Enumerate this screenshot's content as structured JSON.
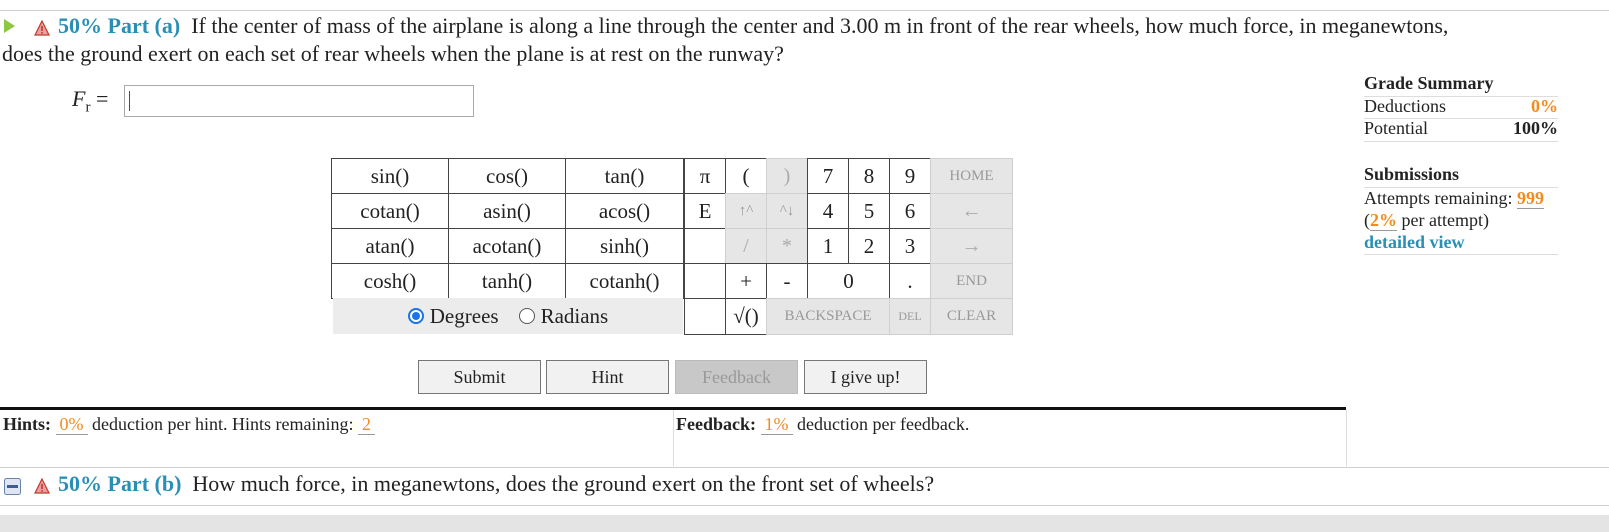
{
  "part_a": {
    "title": "50% Part (a)",
    "question_line1": "If the center of mass of the airplane is along a line through the center and 3.00 m in front of the rear wheels, how much force, in meganewtons,",
    "question_line2": "does the ground exert on each set of rear wheels when the plane is at rest on the runway?",
    "answer_label": "F",
    "answer_sub": "r",
    "answer_eq": "=",
    "answer_value": ""
  },
  "keypad": {
    "functions": [
      [
        "sin()",
        "cos()",
        "tan()"
      ],
      [
        "cotan()",
        "asin()",
        "acos()"
      ],
      [
        "atan()",
        "acotan()",
        "sinh()"
      ],
      [
        "cosh()",
        "tanh()",
        "cotanh()"
      ]
    ],
    "mode_degrees": "Degrees",
    "mode_radians": "Radians",
    "pi": "π",
    "lparen": "(",
    "rparen": ")",
    "e": "E",
    "up": "↑^",
    "down": "^↓",
    "slash": "/",
    "star": "*",
    "plus": "+",
    "minus": "-",
    "n7": "7",
    "n8": "8",
    "n9": "9",
    "n4": "4",
    "n5": "5",
    "n6": "6",
    "n1": "1",
    "n2": "2",
    "n3": "3",
    "n0": "0",
    "dot": ".",
    "sqrt": "√()",
    "home": "HOME",
    "left": "←",
    "right": "→",
    "end": "END",
    "backspace": "BACKSPACE",
    "del": "DEL",
    "clear": "CLEAR"
  },
  "buttons": {
    "submit": "Submit",
    "hint": "Hint",
    "feedback": "Feedback",
    "give_up": "I give up!"
  },
  "hints": {
    "label": "Hints:",
    "pct": "0%",
    "text": "deduction per hint. Hints remaining:",
    "remaining": "2"
  },
  "feedback": {
    "label": "Feedback:",
    "pct": "1%",
    "text": "deduction per feedback."
  },
  "grade_summary": {
    "title": "Grade Summary",
    "deductions_label": "Deductions",
    "deductions_value": "0%",
    "potential_label": "Potential",
    "potential_value": "100%"
  },
  "submissions": {
    "title": "Submissions",
    "attempts_label": "Attempts remaining:",
    "attempts_value": "999",
    "per_attempt_pct": "2%",
    "per_attempt_text": "per attempt)",
    "per_attempt_open": "(",
    "detailed_view": "detailed view"
  },
  "part_b": {
    "title": "50% Part (b)",
    "question": "How much force, in meganewtons, does the ground exert on the front set of wheels?"
  },
  "colors": {
    "accent": "#2a8fb5",
    "orange": "#f28c1e",
    "radio": "#1a73e8"
  }
}
